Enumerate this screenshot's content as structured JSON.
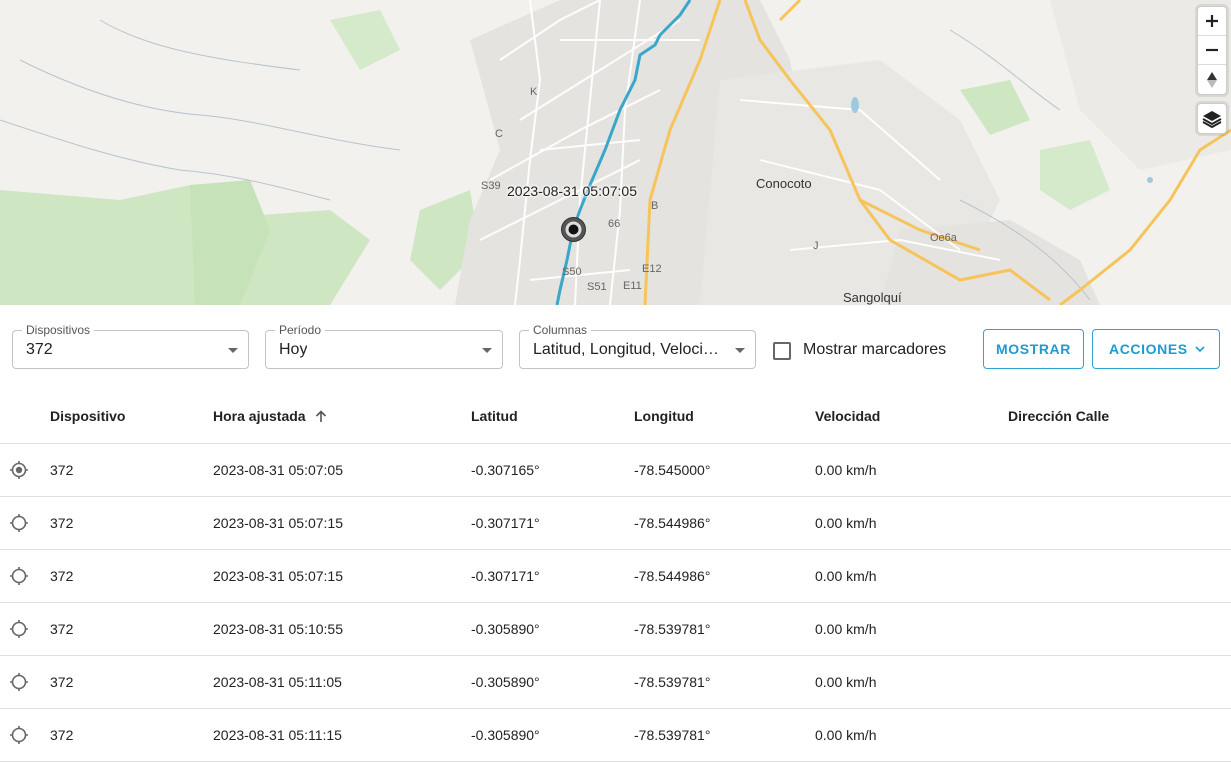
{
  "map": {
    "marker_time": "2023-08-31 05:07:05",
    "places": [
      {
        "name": "Conocoto"
      },
      {
        "name": "Sangolquí"
      }
    ],
    "roads": [
      "S39",
      "S50",
      "S51",
      "E12",
      "E11",
      "B",
      "J",
      "K",
      "C",
      "Oe6a",
      "66"
    ],
    "controls": {
      "zoom_in_icon": "plus-icon",
      "zoom_out_icon": "minus-icon",
      "compass_icon": "compass-icon",
      "layers_icon": "layers-icon"
    },
    "route_color": "#3aa6c9"
  },
  "filters": {
    "devices": {
      "label": "Dispositivos",
      "value": "372"
    },
    "period": {
      "label": "Período",
      "value": "Hoy"
    },
    "columns": {
      "label": "Columnas",
      "value": "Latitud, Longitud, Velocidad"
    },
    "show_markers": {
      "label": "Mostrar marcadores",
      "checked": false
    },
    "show_button": "MOSTRAR",
    "actions_button": "ACCIONES"
  },
  "colors": {
    "accent": "#1e9ad2"
  },
  "table": {
    "headers": [
      "Dispositivo",
      "Hora ajustada",
      "Latitud",
      "Longitud",
      "Velocidad",
      "Dirección Calle"
    ],
    "sort_column": "Hora ajustada",
    "rows": [
      {
        "device": "372",
        "time": "2023-08-31 05:07:05",
        "lat": "-0.307165°",
        "lon": "-78.545000°",
        "speed": "0.00 km/h",
        "address": "",
        "selected": true
      },
      {
        "device": "372",
        "time": "2023-08-31 05:07:15",
        "lat": "-0.307171°",
        "lon": "-78.544986°",
        "speed": "0.00 km/h",
        "address": "",
        "selected": false
      },
      {
        "device": "372",
        "time": "2023-08-31 05:07:15",
        "lat": "-0.307171°",
        "lon": "-78.544986°",
        "speed": "0.00 km/h",
        "address": "",
        "selected": false
      },
      {
        "device": "372",
        "time": "2023-08-31 05:10:55",
        "lat": "-0.305890°",
        "lon": "-78.539781°",
        "speed": "0.00 km/h",
        "address": "",
        "selected": false
      },
      {
        "device": "372",
        "time": "2023-08-31 05:11:05",
        "lat": "-0.305890°",
        "lon": "-78.539781°",
        "speed": "0.00 km/h",
        "address": "",
        "selected": false
      },
      {
        "device": "372",
        "time": "2023-08-31 05:11:15",
        "lat": "-0.305890°",
        "lon": "-78.539781°",
        "speed": "0.00 km/h",
        "address": "",
        "selected": false
      }
    ]
  }
}
